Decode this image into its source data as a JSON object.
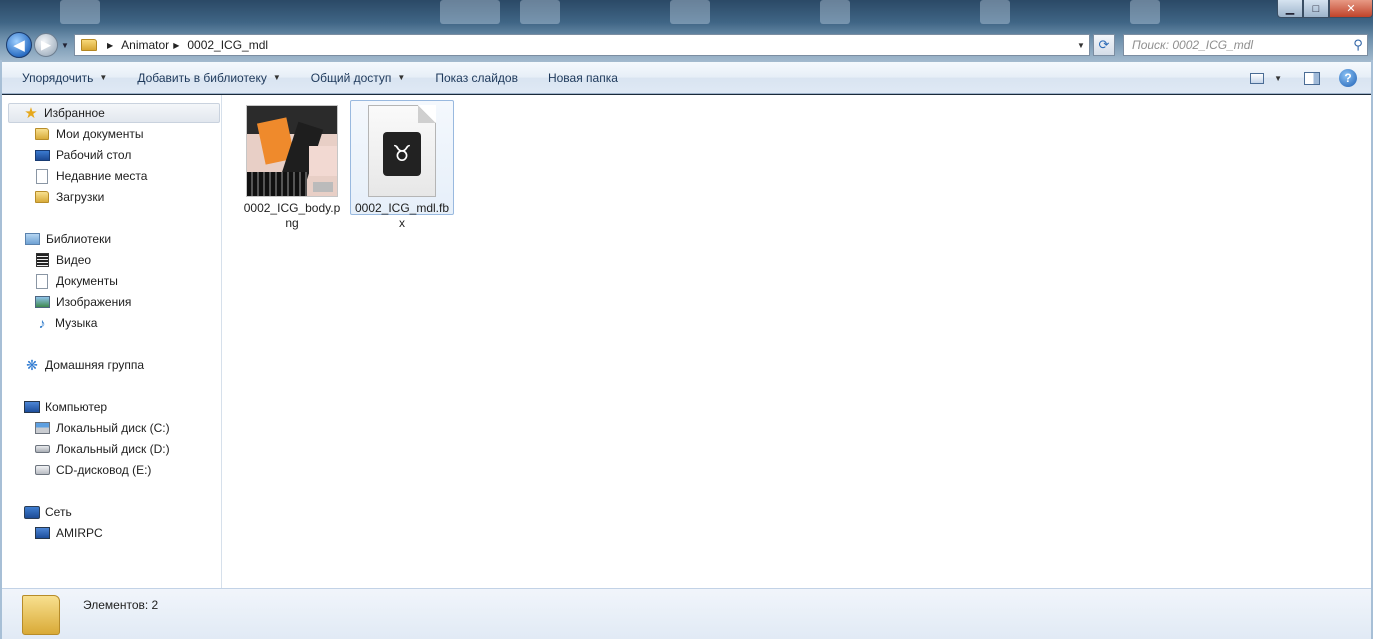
{
  "window": {
    "min_glyph": "▁",
    "max_glyph": "□",
    "close_glyph": "✕"
  },
  "address": {
    "segments": [
      "Animator",
      "0002_ICG_mdl"
    ]
  },
  "search": {
    "placeholder": "Поиск: 0002_ICG_mdl"
  },
  "toolbar": {
    "organize": "Упорядочить",
    "add_to_library": "Добавить в библиотеку",
    "share": "Общий доступ",
    "slideshow": "Показ слайдов",
    "new_folder": "Новая папка"
  },
  "nav": {
    "favorites": {
      "label": "Избранное",
      "items": [
        "Мои документы",
        "Рабочий стол",
        "Недавние места",
        "Загрузки"
      ]
    },
    "libraries": {
      "label": "Библиотеки",
      "items": [
        "Видео",
        "Документы",
        "Изображения",
        "Музыка"
      ]
    },
    "homegroup": {
      "label": "Домашняя группа"
    },
    "computer": {
      "label": "Компьютер",
      "items": [
        "Локальный диск (C:)",
        "Локальный диск (D:)",
        "CD-дисковод (E:)"
      ]
    },
    "network": {
      "label": "Сеть",
      "items": [
        "AMIRPC"
      ]
    }
  },
  "files": [
    {
      "name": "0002_ICG_body.png",
      "selected": false
    },
    {
      "name": "0002_ICG_mdl.fbx",
      "selected": true
    }
  ],
  "details": {
    "count_text": "Элементов: 2"
  },
  "colors": {
    "accent": "#1e395b",
    "selection": "#99b9df",
    "window_frame": "#a7bfd6"
  }
}
